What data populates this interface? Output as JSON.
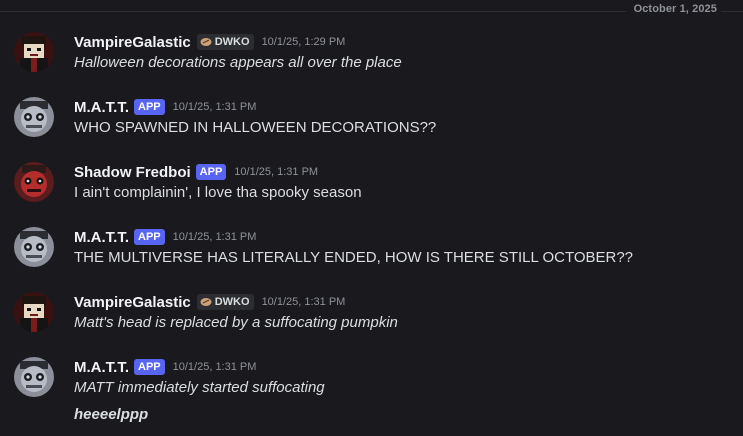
{
  "date_divider": "October 1, 2025",
  "colors": {
    "background": "#1a1a1e",
    "app_tag": "#5865f2",
    "username": "#f2f3f5",
    "timestamp": "#8e9297",
    "text": "#dbdee1"
  },
  "messages": [
    {
      "author": "VampireGalastic",
      "tag": "DWKO",
      "tag_icon": "guild-tag-icon",
      "time": "10/1/25, 1:29 PM",
      "lines": [
        {
          "text": "Halloween decorations appears all over the place",
          "style": "italic"
        }
      ]
    },
    {
      "author": "M.A.T.T.",
      "tag": "APP",
      "time": "10/1/25, 1:31 PM",
      "lines": [
        {
          "text": "WHO SPAWNED IN HALLOWEEN DECORATIONS??",
          "style": "normal"
        }
      ]
    },
    {
      "author": "Shadow Fredboi",
      "tag": "APP",
      "time": "10/1/25, 1:31 PM",
      "lines": [
        {
          "text": "I ain't complainin', I love tha spooky season",
          "style": "normal"
        }
      ]
    },
    {
      "author": "M.A.T.T.",
      "tag": "APP",
      "time": "10/1/25, 1:31 PM",
      "lines": [
        {
          "text": "THE MULTIVERSE HAS LITERALLY ENDED, HOW IS THERE STILL OCTOBER??",
          "style": "normal"
        }
      ]
    },
    {
      "author": "VampireGalastic",
      "tag": "DWKO",
      "tag_icon": "guild-tag-icon",
      "time": "10/1/25, 1:31 PM",
      "lines": [
        {
          "text": "Matt's head is replaced by a suffocating pumpkin",
          "style": "italic"
        }
      ]
    },
    {
      "author": "M.A.T.T.",
      "tag": "APP",
      "time": "10/1/25, 1:31 PM",
      "lines": [
        {
          "text": "MATT immediately started suffocating",
          "style": "italic"
        },
        {
          "text": "heeeelppp",
          "style": "bold-italic"
        }
      ]
    }
  ]
}
